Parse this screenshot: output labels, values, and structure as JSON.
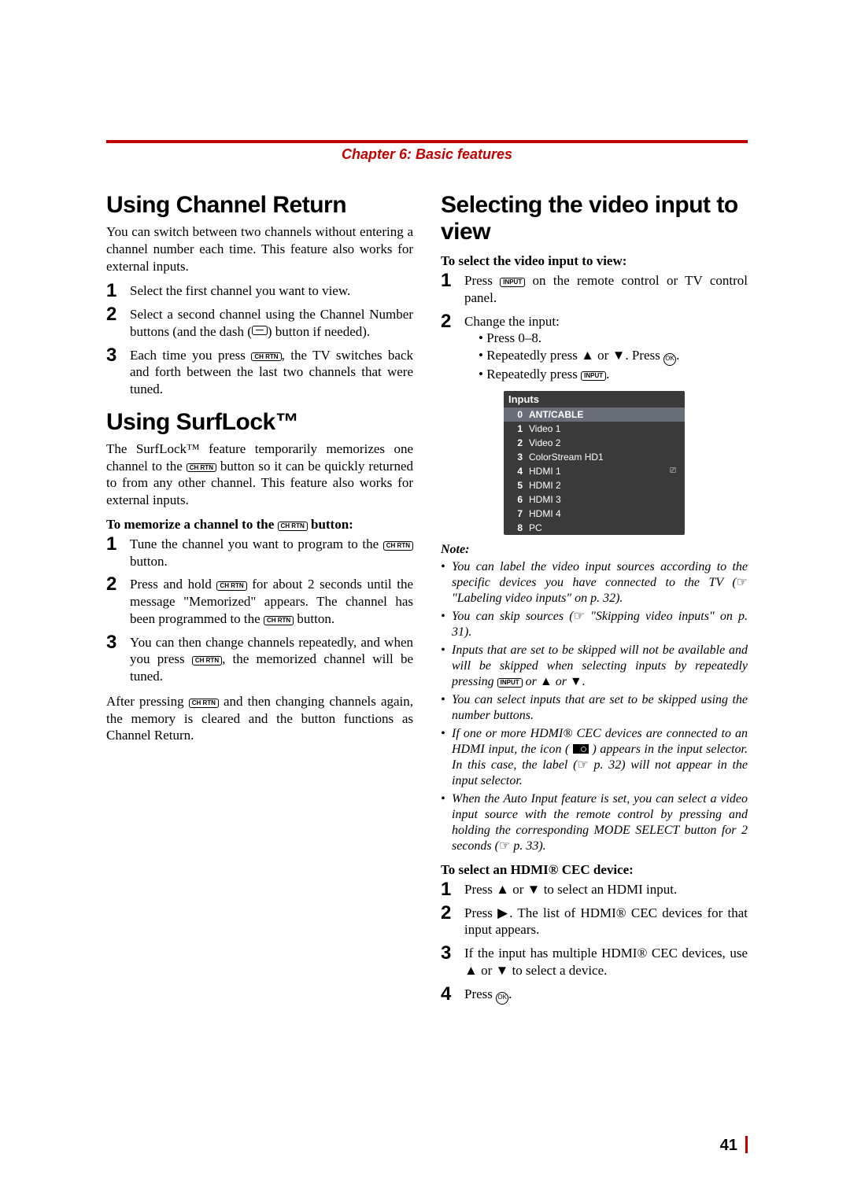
{
  "chapter": {
    "title": "Chapter 6: Basic features"
  },
  "page_number": "41",
  "left": {
    "h1": "Using Channel Return",
    "p1": "You can switch between two channels without entering a channel number each time. This feature also works for external inputs.",
    "s1": "Select the first channel you want to view.",
    "s2a": "Select a second channel using the Channel Number buttons (and the dash (",
    "s2b": ") button if needed).",
    "s3a": "Each time you press ",
    "s3b": ", the TV switches back and forth between the last two channels that were tuned.",
    "h2": "Using SurfLock™",
    "p2a": "The SurfLock™ feature temporarily memorizes one channel to the ",
    "p2b": " button so it can be quickly returned to from any other channel. This feature also works for external inputs.",
    "lead_a": "To memorize a channel to the ",
    "lead_b": " button:",
    "t1a": "Tune the channel you want to program to the ",
    "t1b": " button.",
    "t2a": "Press and hold ",
    "t2b": " for about 2 seconds until the message \"Memorized\" appears. The channel has been programmed to the ",
    "t2c": " button.",
    "t3a": "You can then change channels repeatedly, and when you press ",
    "t3b": ", the memorized channel will be tuned.",
    "after_a": "After pressing ",
    "after_b": " and then changing channels again, the memory is cleared and the button functions as Channel Return."
  },
  "right": {
    "h1": "Selecting the video input to view",
    "lead1": "To select the video input to view:",
    "s1a": "Press ",
    "s1b": " on the remote control or TV control panel.",
    "s2": "Change the input:",
    "s2b1": "• Press 0–8.",
    "s2b2a": "• Repeatedly press ▲ or ▼. Press ",
    "s2b2b": ".",
    "s2b3a": "• Repeatedly press ",
    "s2b3b": ".",
    "note_head": "Note:",
    "n1a": "You can label the video input sources according to the specific devices you have connected to the TV (",
    "n1b": " \"Labeling video inputs\" on p. 32).",
    "n2a": "You can skip sources (",
    "n2b": " \"Skipping video inputs\" on p. 31).",
    "n3a": "Inputs that are set to be skipped will not be available and will be skipped when selecting inputs by repeatedly pressing ",
    "n3b": " or ▲ or ▼.",
    "n4": "You can select inputs that are set to be skipped using the number buttons.",
    "n5a": "If one or more HDMI® CEC devices are connected to an HDMI input, the icon ( ",
    "n5b": " ) appears in the input selector. In this case, the label (",
    "n5c": " p. 32) will not appear in the input selector.",
    "n6a": "When the Auto Input feature is set, you can select a video input source with the remote control by pressing and holding the corresponding MODE SELECT button for 2 seconds (",
    "n6b": " p. 33).",
    "lead2": "To select an HDMI® CEC device:",
    "c1": "Press ▲ or ▼ to select an HDMI input.",
    "c2": "Press ▶. The list of HDMI® CEC devices for that input appears.",
    "c3": "If the input has multiple HDMI® CEC devices, use ▲ or ▼ to select a device.",
    "c4a": "Press ",
    "c4b": "."
  },
  "btn": {
    "chrtn": "CH RTN",
    "input": "INPUT",
    "ok": "OK"
  },
  "inputs_panel": {
    "title": "Inputs",
    "rows": [
      {
        "n": "0",
        "label": "ANT/CABLE",
        "sel": true,
        "icon": ""
      },
      {
        "n": "1",
        "label": "Video 1",
        "sel": false,
        "icon": ""
      },
      {
        "n": "2",
        "label": "Video 2",
        "sel": false,
        "icon": ""
      },
      {
        "n": "3",
        "label": "ColorStream HD1",
        "sel": false,
        "icon": ""
      },
      {
        "n": "4",
        "label": "HDMI 1",
        "sel": false,
        "icon": "cec"
      },
      {
        "n": "5",
        "label": "HDMI 2",
        "sel": false,
        "icon": ""
      },
      {
        "n": "6",
        "label": "HDMI 3",
        "sel": false,
        "icon": ""
      },
      {
        "n": "7",
        "label": "HDMI 4",
        "sel": false,
        "icon": ""
      },
      {
        "n": "8",
        "label": "PC",
        "sel": false,
        "icon": ""
      }
    ]
  }
}
